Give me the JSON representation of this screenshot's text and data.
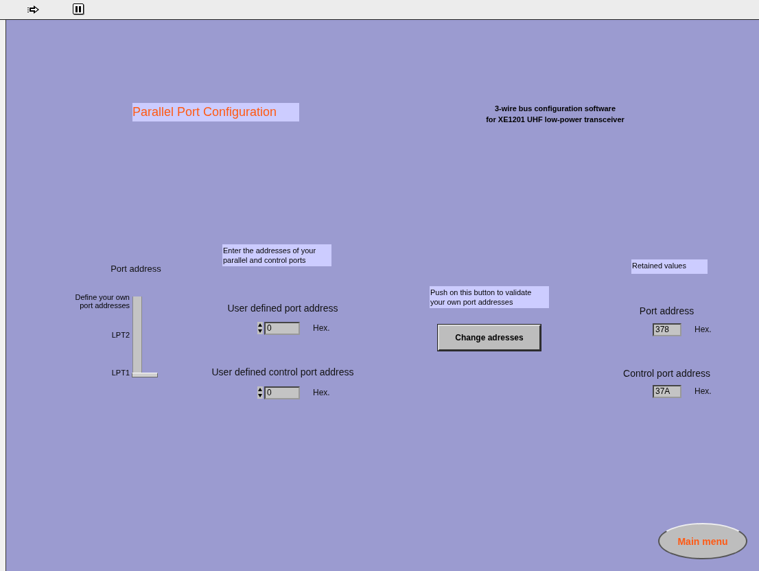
{
  "title": "Parallel Port Configuration",
  "subtitle": [
    "3-wire bus configuration software",
    "for XE1201 UHF low-power transceiver"
  ],
  "slider": {
    "label": "Port address",
    "ticks": [
      "Define your own port addresses",
      "LPT2",
      "LPT1"
    ],
    "level": 0
  },
  "enter_note": "Enter the addresses of your parallel and control ports",
  "user_fields": [
    {
      "label": "User defined port address",
      "value": "0",
      "unit": "Hex."
    },
    {
      "label": "User defined control port address",
      "value": "0",
      "unit": "Hex."
    }
  ],
  "push_note": "Push on this button to validate your own port addresses",
  "change_button": "Change adresses",
  "retained": {
    "label": "Retained values",
    "items": [
      {
        "label": "Port address",
        "value": "378",
        "unit": "Hex."
      },
      {
        "label": "Control port address",
        "value": "37A",
        "unit": "Hex."
      }
    ]
  },
  "main_menu": "Main menu"
}
